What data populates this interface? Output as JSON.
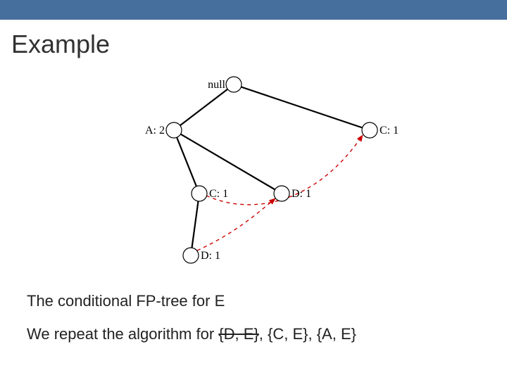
{
  "title": "Example",
  "tree": {
    "nodes": {
      "root": "null",
      "a": "A: 2",
      "c_r": "C: 1",
      "c_l": "C: 1",
      "d_l": "D: 1",
      "d_r": "D: 1"
    },
    "solid_edges": [
      [
        "root",
        "a"
      ],
      [
        "root",
        "c_r"
      ],
      [
        "a",
        "c_l"
      ],
      [
        "a",
        "d_r"
      ],
      [
        "c_l",
        "d_l"
      ]
    ],
    "dashed_links": [
      [
        "c_l",
        "c_r"
      ],
      [
        "d_l",
        "d_r"
      ]
    ]
  },
  "caption1": "The conditional FP-tree for E",
  "caption2_pre": "We repeat the algorithm for ",
  "caption2_strike": "{D, E}",
  "caption2_post": ", {C, E}, {A, E}"
}
